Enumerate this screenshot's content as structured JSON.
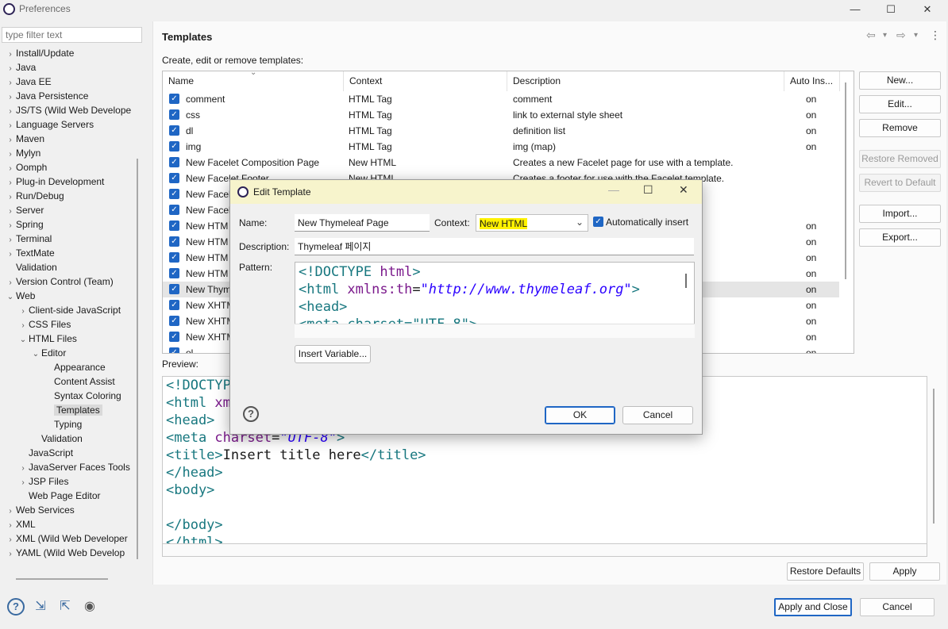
{
  "window": {
    "title": "Preferences",
    "minimize": "—",
    "maximize": "☐",
    "close": "✕"
  },
  "sidebar": {
    "filter_placeholder": "type filter text",
    "items": [
      {
        "label": "Install/Update",
        "level": 0,
        "twisty": "›"
      },
      {
        "label": "Java",
        "level": 0,
        "twisty": "›"
      },
      {
        "label": "Java EE",
        "level": 0,
        "twisty": "›"
      },
      {
        "label": "Java Persistence",
        "level": 0,
        "twisty": "›"
      },
      {
        "label": "JS/TS (Wild Web Develope",
        "level": 0,
        "twisty": "›"
      },
      {
        "label": "Language Servers",
        "level": 0,
        "twisty": "›"
      },
      {
        "label": "Maven",
        "level": 0,
        "twisty": "›"
      },
      {
        "label": "Mylyn",
        "level": 0,
        "twisty": "›"
      },
      {
        "label": "Oomph",
        "level": 0,
        "twisty": "›"
      },
      {
        "label": "Plug-in Development",
        "level": 0,
        "twisty": "›"
      },
      {
        "label": "Run/Debug",
        "level": 0,
        "twisty": "›"
      },
      {
        "label": "Server",
        "level": 0,
        "twisty": "›"
      },
      {
        "label": "Spring",
        "level": 0,
        "twisty": "›"
      },
      {
        "label": "Terminal",
        "level": 0,
        "twisty": "›"
      },
      {
        "label": "TextMate",
        "level": 0,
        "twisty": "›"
      },
      {
        "label": "Validation",
        "level": 0,
        "twisty": ""
      },
      {
        "label": "Version Control (Team)",
        "level": 0,
        "twisty": "›"
      },
      {
        "label": "Web",
        "level": 0,
        "twisty": "⌄"
      },
      {
        "label": "Client-side JavaScript",
        "level": 1,
        "twisty": "›"
      },
      {
        "label": "CSS Files",
        "level": 1,
        "twisty": "›"
      },
      {
        "label": "HTML Files",
        "level": 1,
        "twisty": "⌄"
      },
      {
        "label": "Editor",
        "level": 2,
        "twisty": "⌄"
      },
      {
        "label": "Appearance",
        "level": 3,
        "twisty": ""
      },
      {
        "label": "Content Assist",
        "level": 3,
        "twisty": ""
      },
      {
        "label": "Syntax Coloring",
        "level": 3,
        "twisty": ""
      },
      {
        "label": "Templates",
        "level": 3,
        "twisty": "",
        "selected": true
      },
      {
        "label": "Typing",
        "level": 3,
        "twisty": ""
      },
      {
        "label": "Validation",
        "level": 2,
        "twisty": ""
      },
      {
        "label": "JavaScript",
        "level": 1,
        "twisty": ""
      },
      {
        "label": "JavaServer Faces Tools",
        "level": 1,
        "twisty": "›"
      },
      {
        "label": "JSP Files",
        "level": 1,
        "twisty": "›"
      },
      {
        "label": "Web Page Editor",
        "level": 1,
        "twisty": ""
      },
      {
        "label": "Web Services",
        "level": 0,
        "twisty": "›"
      },
      {
        "label": "XML",
        "level": 0,
        "twisty": "›"
      },
      {
        "label": "XML (Wild Web Developer",
        "level": 0,
        "twisty": "›"
      },
      {
        "label": "YAML (Wild Web Develop",
        "level": 0,
        "twisty": "›"
      }
    ]
  },
  "page": {
    "title": "Templates",
    "description": "Create, edit or remove templates:",
    "nav": {
      "back": "⇦",
      "back_menu": "▾",
      "forward": "⇨",
      "forward_menu": "▾",
      "more": "⋮"
    }
  },
  "table": {
    "columns": [
      "Name",
      "Context",
      "Description",
      "Auto Ins..."
    ],
    "sort_indicator": "⌄",
    "rows": [
      {
        "name": "comment",
        "context": "HTML Tag",
        "description": "comment",
        "auto": "on"
      },
      {
        "name": "css",
        "context": "HTML Tag",
        "description": "link to external style sheet",
        "auto": "on"
      },
      {
        "name": "dl",
        "context": "HTML Tag",
        "description": "definition list",
        "auto": "on"
      },
      {
        "name": "img",
        "context": "HTML Tag",
        "description": "img      (map)",
        "auto": "on"
      },
      {
        "name": "New Facelet Composition Page",
        "context": "New HTML",
        "description": "Creates a new Facelet page for use with a template.",
        "auto": ""
      },
      {
        "name": "New Facelet Footer",
        "context": "New HTML",
        "description": "Creates a footer for use with the Facelet template.",
        "auto": ""
      },
      {
        "name": "New Facel",
        "context": "",
        "description": "mplate.",
        "auto": ""
      },
      {
        "name": "New Facel",
        "context": "",
        "description": "t template.",
        "auto": ""
      },
      {
        "name": "New HTM",
        "context": "",
        "description": "",
        "auto": "on"
      },
      {
        "name": "New HTM",
        "context": "",
        "description": "",
        "auto": "on"
      },
      {
        "name": "New HTM",
        "context": "",
        "description": "",
        "auto": "on"
      },
      {
        "name": "New HTM",
        "context": "",
        "description": "",
        "auto": "on"
      },
      {
        "name": "New Thym",
        "context": "",
        "description": "",
        "auto": "on",
        "selected": true
      },
      {
        "name": "New XHTM",
        "context": "",
        "description": "",
        "auto": "on"
      },
      {
        "name": "New XHTM",
        "context": "",
        "description": "",
        "auto": "on"
      },
      {
        "name": "New XHTM",
        "context": "",
        "description": "",
        "auto": "on"
      },
      {
        "name": "ol",
        "context": "",
        "description": "",
        "auto": "on"
      }
    ]
  },
  "side_buttons": {
    "new": "New...",
    "edit": "Edit...",
    "remove": "Remove",
    "restore_removed": "Restore Removed",
    "revert_default": "Revert to Default",
    "import": "Import...",
    "export": "Export..."
  },
  "preview": {
    "label": "Preview:",
    "lines": [
      [
        "<!DOCTYP"
      ],
      [
        "<html xm"
      ],
      [
        "<head>"
      ],
      [
        "<meta charset=\"UTF-8\">"
      ],
      [
        "<title>Insert title here</title>"
      ],
      [
        "</head>"
      ],
      [
        "<body>"
      ],
      [
        ""
      ],
      [
        "</body>"
      ],
      [
        "</html>"
      ]
    ],
    "seg": {
      "l0": "<!DOCTYP",
      "l1a": "<html ",
      "l1b": "xm",
      "l2": "<head>",
      "l3a": "<meta ",
      "l3b": "charset",
      "l3c": "=",
      "l3d": "\"UTF-8\"",
      "l3e": ">",
      "l4a": "<title>",
      "l4b": "Insert title here",
      "l4c": "</title>",
      "l5": "</head>",
      "l6": "<body>",
      "l8": "</body>",
      "l9": "</html>"
    }
  },
  "bottom": {
    "restore_defaults": "Restore Defaults",
    "apply": "Apply",
    "apply_close": "Apply and Close",
    "cancel": "Cancel",
    "icons": {
      "help": "?",
      "import": "⇲",
      "export": "⇱",
      "record": "◉"
    }
  },
  "dialog": {
    "title": "Edit Template",
    "minimize": "—",
    "maximize": "☐",
    "close": "✕",
    "name_label": "Name:",
    "name_value": "New Thymeleaf Page",
    "context_label": "Context:",
    "context_value": "New HTML",
    "context_arrow": "⌄",
    "auto_insert_label": "Automatically insert",
    "description_label": "Description:",
    "description_value": "Thymeleaf  페이지",
    "pattern_label": "Pattern:",
    "pattern": {
      "l0a": "<!DOCTYPE ",
      "l0b": "html",
      "l0c": ">",
      "l1a": "<html ",
      "l1b": "xmlns:th",
      "l1c": "=",
      "l1d": "\"http://www.thymeleaf.org\"",
      "l1e": ">",
      "l2": "<head>",
      "l3": "<meta charset=\"UTF-8\">"
    },
    "insert_variable": "Insert Variable...",
    "help": "?",
    "ok": "OK",
    "cancel": "Cancel"
  }
}
